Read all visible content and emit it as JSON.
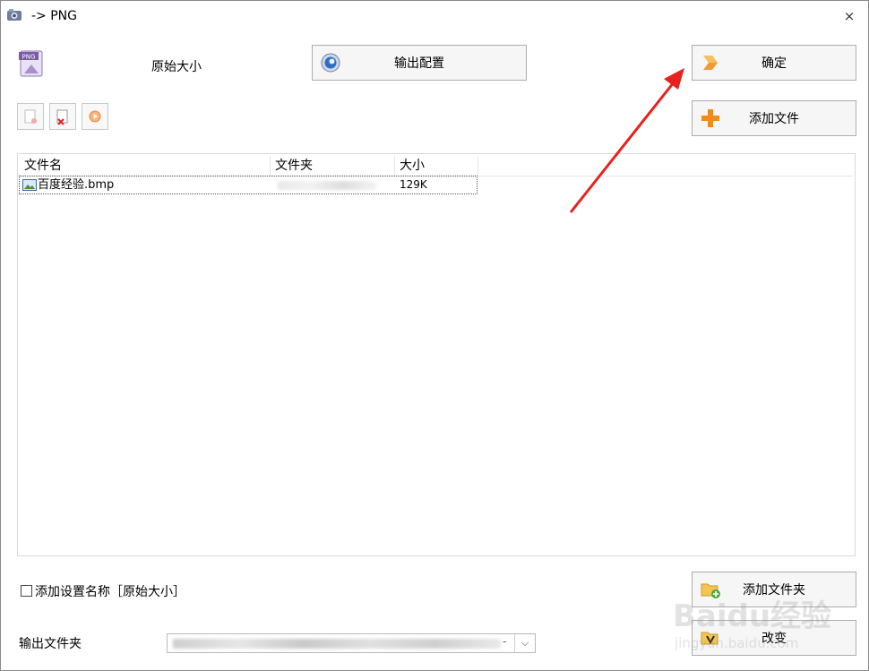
{
  "window": {
    "title": "-> PNG",
    "close": "×"
  },
  "header": {
    "format_badge": "PNG",
    "size_label": "原始大小"
  },
  "buttons": {
    "output_config": "输出配置",
    "confirm": "确定",
    "add_file": "添加文件",
    "add_folder": "添加文件夹",
    "change": "改变"
  },
  "file_list": {
    "columns": [
      "文件名",
      "文件夹",
      "大小"
    ],
    "rows": [
      {
        "name": "百度经验.bmp",
        "size": "129K"
      }
    ]
  },
  "options": {
    "add_setting_name_label": "添加设置名称［原始大小］",
    "add_setting_name_checked": false
  },
  "output": {
    "label": "输出文件夹",
    "dash": "-",
    "arrow": "⌵"
  },
  "watermark": {
    "brand": "Baidu经验",
    "url": "jingyan.baidu.com"
  },
  "colors": {
    "annotation_arrow": "#e8201e",
    "button_bg": "#f6f6f6",
    "border": "#adadad"
  },
  "icons": {
    "app": "converter-app-icon",
    "format": "png-format-icon",
    "config": "gear-icon",
    "confirm": "arrow-right-icon",
    "add_file": "plus-icon",
    "add_folder": "folder-add-icon",
    "change": "folder-edit-icon"
  }
}
